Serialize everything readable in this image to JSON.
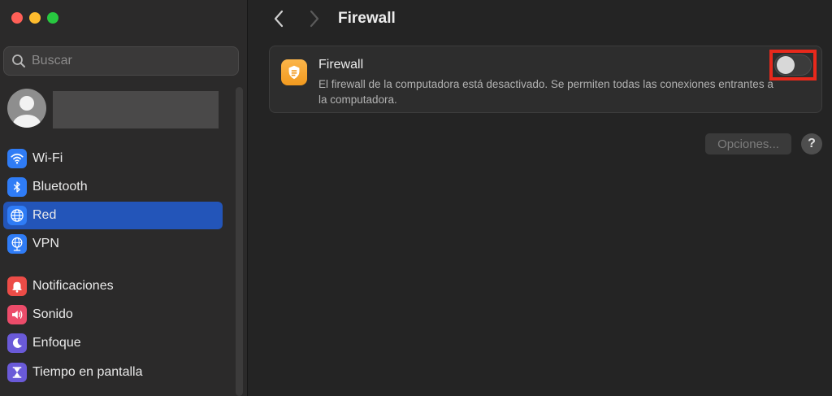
{
  "sidebar": {
    "search": {
      "placeholder": "Buscar",
      "icon": "search-icon"
    },
    "items": [
      {
        "label": "Wi-Fi",
        "icon": "wifi-icon",
        "color": "#2f7cf6",
        "active": false
      },
      {
        "label": "Bluetooth",
        "icon": "bluetooth-icon",
        "color": "#2f7cf6",
        "active": false
      },
      {
        "label": "Red",
        "icon": "globe-icon",
        "color": "#2f7cf6",
        "active": true
      },
      {
        "label": "VPN",
        "icon": "vpn-globe-icon",
        "color": "#2f7cf6",
        "active": false
      },
      {
        "label": "Notificaciones",
        "icon": "bell-icon",
        "color": "#ec4c47",
        "active": false
      },
      {
        "label": "Sonido",
        "icon": "speaker-icon",
        "color": "#ec4c6a",
        "active": false
      },
      {
        "label": "Enfoque",
        "icon": "moon-icon",
        "color": "#6a5ad8",
        "active": false
      },
      {
        "label": "Tiempo en pantalla",
        "icon": "hourglass-icon",
        "color": "#6a5ad8",
        "active": false
      }
    ]
  },
  "header": {
    "title": "Firewall"
  },
  "firewall": {
    "title": "Firewall",
    "description": "El firewall de la computadora está desactivado. Se permiten todas las conexiones entrantes a la computadora.",
    "enabled": false,
    "icon": "firewall-shield-icon",
    "accent": "#f5a623"
  },
  "actions": {
    "options_label": "Opciones...",
    "help_label": "?"
  },
  "colors": {
    "highlight": "#e8291c",
    "selection": "#2355b9"
  }
}
